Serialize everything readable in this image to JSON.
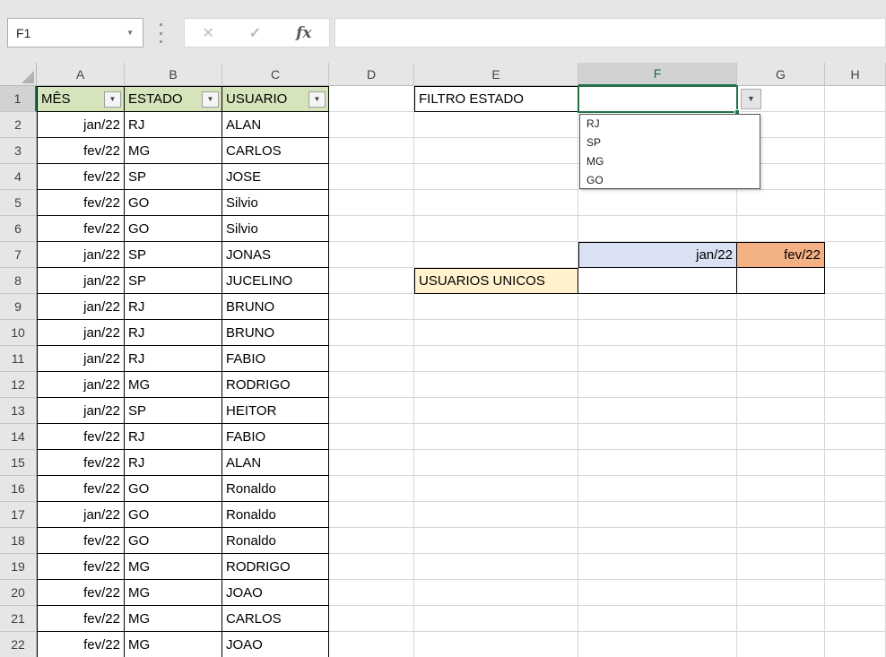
{
  "name_box": {
    "value": "F1"
  },
  "formula_bar": {
    "value": ""
  },
  "icons": {
    "cancel": "✕",
    "enter": "✓",
    "function": "fx",
    "namebox_caret": "▼",
    "filter": "▼",
    "dropdown": "▼"
  },
  "colors": {
    "accent_green": "#217346",
    "table_header_fill": "#D6E4BC",
    "jan_fill": "#D9E1F2",
    "fev_fill": "#F4B183",
    "label_fill": "#FFF2CC"
  },
  "grid": {
    "active_cell": "F1",
    "selected_column": "F",
    "selected_row": "1",
    "column_letters": [
      "A",
      "B",
      "C",
      "D",
      "E",
      "F",
      "G",
      "H"
    ],
    "row_numbers": [
      "1",
      "2",
      "3",
      "4",
      "5",
      "6",
      "7",
      "8",
      "9",
      "10",
      "11",
      "12",
      "13",
      "14",
      "15",
      "16",
      "17",
      "18",
      "19",
      "20",
      "21",
      "22"
    ]
  },
  "table": {
    "headers": [
      "MÊS",
      "ESTADO",
      "USUARIO"
    ],
    "rows": [
      {
        "mes": "jan/22",
        "estado": "RJ",
        "usuario": "ALAN"
      },
      {
        "mes": "fev/22",
        "estado": "MG",
        "usuario": "CARLOS"
      },
      {
        "mes": "fev/22",
        "estado": "SP",
        "usuario": "JOSE"
      },
      {
        "mes": "fev/22",
        "estado": "GO",
        "usuario": "Silvio"
      },
      {
        "mes": "fev/22",
        "estado": "GO",
        "usuario": "Silvio"
      },
      {
        "mes": "jan/22",
        "estado": "SP",
        "usuario": "JONAS"
      },
      {
        "mes": "jan/22",
        "estado": "SP",
        "usuario": "JUCELINO"
      },
      {
        "mes": "jan/22",
        "estado": "RJ",
        "usuario": "BRUNO"
      },
      {
        "mes": "jan/22",
        "estado": "RJ",
        "usuario": "BRUNO"
      },
      {
        "mes": "jan/22",
        "estado": "RJ",
        "usuario": "FABIO"
      },
      {
        "mes": "jan/22",
        "estado": "MG",
        "usuario": "RODRIGO"
      },
      {
        "mes": "jan/22",
        "estado": "SP",
        "usuario": "HEITOR"
      },
      {
        "mes": "fev/22",
        "estado": "RJ",
        "usuario": "FABIO"
      },
      {
        "mes": "fev/22",
        "estado": "RJ",
        "usuario": "ALAN"
      },
      {
        "mes": "fev/22",
        "estado": "GO",
        "usuario": "Ronaldo"
      },
      {
        "mes": "jan/22",
        "estado": "GO",
        "usuario": "Ronaldo"
      },
      {
        "mes": "fev/22",
        "estado": "GO",
        "usuario": "Ronaldo"
      },
      {
        "mes": "fev/22",
        "estado": "MG",
        "usuario": "RODRIGO"
      },
      {
        "mes": "fev/22",
        "estado": "MG",
        "usuario": "JOAO"
      },
      {
        "mes": "fev/22",
        "estado": "MG",
        "usuario": "CARLOS"
      },
      {
        "mes": "fev/22",
        "estado": "MG",
        "usuario": "JOAO"
      }
    ]
  },
  "filter": {
    "label": "FILTRO ESTADO",
    "selected_value": "",
    "options": [
      "RJ",
      "SP",
      "MG",
      "GO"
    ]
  },
  "summary": {
    "label": "USUARIOS UNICOS",
    "months": [
      "jan/22",
      "fev/22"
    ],
    "values": [
      "",
      ""
    ]
  }
}
